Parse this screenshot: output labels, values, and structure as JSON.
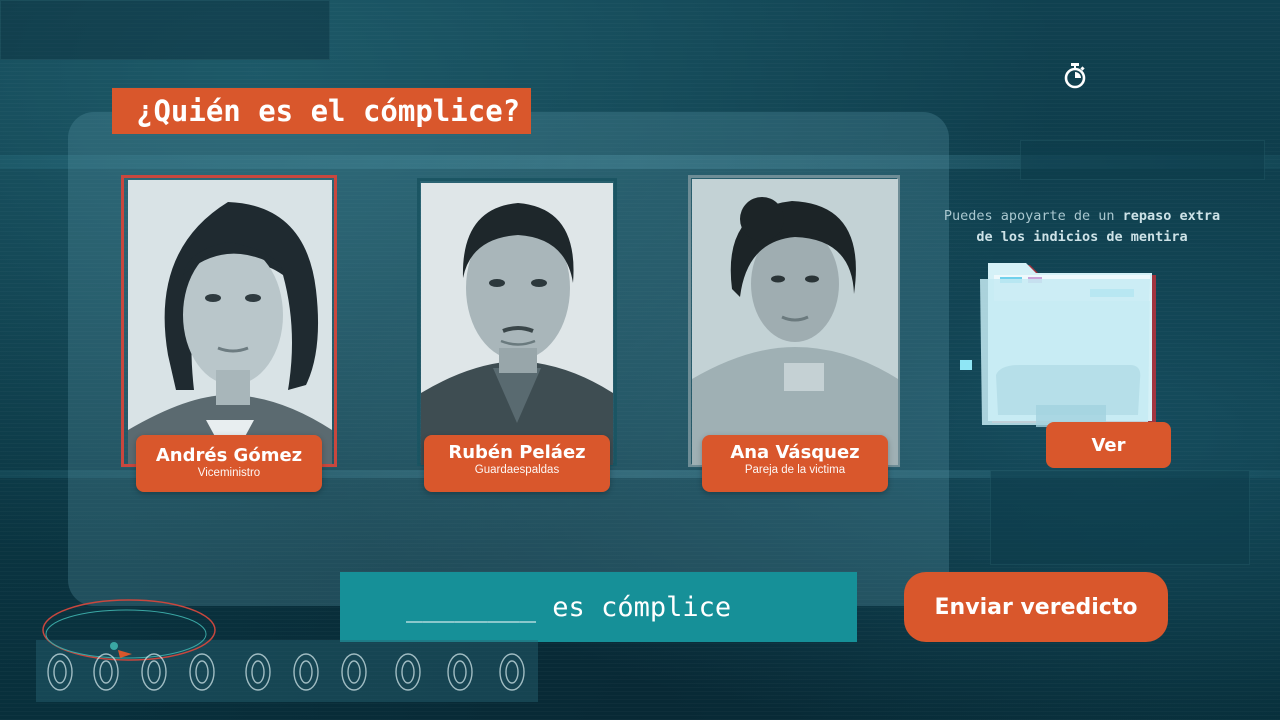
{
  "title": "¿Quién es el cómplice?",
  "suspects": [
    {
      "name": "Andrés Gómez",
      "role": "Viceministro"
    },
    {
      "name": "Rubén Peláez",
      "role": "Guardaespaldas"
    },
    {
      "name": "Ana Vásquez",
      "role": "Pareja de la victima"
    }
  ],
  "hint": {
    "part1": "Puedes apoyarte de un ",
    "part2": "repaso extra",
    "part3": "de los indicios de mentira"
  },
  "buttons": {
    "view": "Ver",
    "submit": "Enviar veredicto"
  },
  "answer": {
    "blank": "________",
    "suffix": " es cómplice"
  },
  "icons": {
    "timer": "stopwatch-icon",
    "folder": "folder-icon",
    "fingerprints": "fingerprint-icon"
  },
  "colors": {
    "accent": "#d9572c",
    "answer_box": "#169098",
    "background": "#0d3a47"
  }
}
